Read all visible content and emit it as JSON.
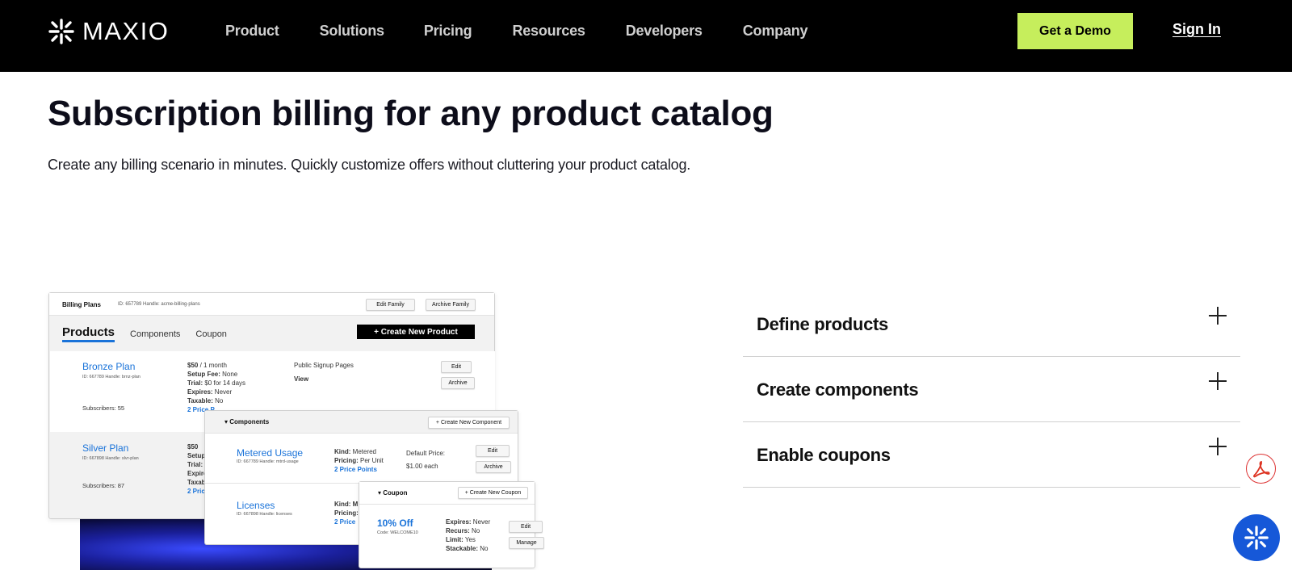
{
  "nav": {
    "logo_text": "MAXIO",
    "links": [
      "Product",
      "Solutions",
      "Pricing",
      "Resources",
      "Developers",
      "Company"
    ],
    "demo_label": "Get a Demo",
    "signin_label": "Sign In"
  },
  "hero": {
    "title": "Subscription billing for any product catalog",
    "subtitle": "Create any billing scenario in minutes. Quickly customize offers without cluttering your product catalog."
  },
  "illustration": {
    "billing_plans": {
      "title": "Billing Plans",
      "meta": "ID: 657789   Handle: acme-billing-plans",
      "edit_family": "Edit Family",
      "archive_family": "Archive Family",
      "tab_active": "Products",
      "tab_components": "Components",
      "tab_coupon": "Coupon",
      "create_product": "+  Create New Product",
      "bronze": {
        "name": "Bronze Plan",
        "id": "ID: 667789   Handle: brnz-plan",
        "subscribers": "Subscribers: 55",
        "price": "$50",
        "price_suffix": " / 1 month",
        "setup_label": "Setup Fee:",
        "setup_val": " None",
        "trial_label": "Trial:",
        "trial_val": " $0 for 14 days",
        "expires_label": "Expires:",
        "expires_val": " Never",
        "taxable_label": "Taxable:",
        "taxable_val": " No",
        "price_points": "2 Price P",
        "signup_label": "Public Signup Pages",
        "view": "View",
        "edit": "Edit",
        "archive": "Archive"
      },
      "silver": {
        "name": "Silver Plan",
        "id": "ID: 667898   Handle: slvr-plan",
        "subscribers": "Subscribers: 87",
        "price": "$50",
        "setup": "Setup",
        "trial": "Trial: ",
        "expires": "Expire",
        "taxable": "Taxab",
        "price_points": "2 Pric"
      }
    },
    "components": {
      "header": "Components",
      "create": "+  Create New Component",
      "metered": {
        "name": "Metered Usage",
        "id": "ID: 667789   Handle: mtrd-usage",
        "kind_label": "Kind:",
        "kind_val": " Metered",
        "pricing_label": "Pricing:",
        "pricing_val": " Per Unit",
        "price_points": "2 Price Points",
        "default_price_label": "Default Price:",
        "default_price_val": "$1.00 each",
        "edit": "Edit",
        "archive": "Archive"
      },
      "licenses": {
        "name": "Licenses",
        "id": "ID: 667898   Handle: licenses",
        "kind": "Kind: M",
        "pricing": "Pricing:",
        "price_points": "2 Price"
      }
    },
    "coupon": {
      "header": "Coupon",
      "create": "+  Create New Coupon",
      "name": "10% Off",
      "code": "Code: WELCOME10",
      "expires_label": "Expires:",
      "expires_val": " Never",
      "recurs_label": "Recurs:",
      "recurs_val": " No",
      "limit_label": "Limit:",
      "limit_val": " Yes",
      "stackable_label": "Stackable:",
      "stackable_val": " No",
      "edit": "Edit",
      "manage": "Manage"
    }
  },
  "accordion": [
    {
      "label": "Define products"
    },
    {
      "label": "Create components"
    },
    {
      "label": "Enable coupons"
    }
  ],
  "colors": {
    "nav_bg": "#000000",
    "demo_bg": "#c6ee5c",
    "link_blue": "#1a73d9",
    "chat_blue": "#1658d8"
  }
}
